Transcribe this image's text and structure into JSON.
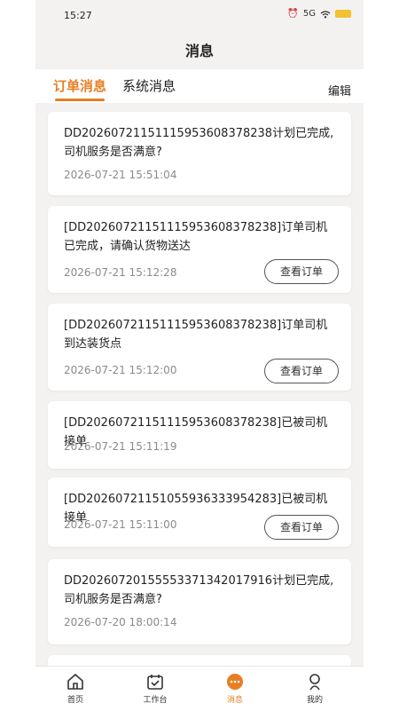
{
  "status": {
    "time": "15:27",
    "network": "5G"
  },
  "header": {
    "title": "消息"
  },
  "tabs": {
    "order_label": "订单消息",
    "system_label": "系统消息",
    "edit_label": "编辑"
  },
  "messages": [
    {
      "text": "DD20260721151115953608378238计划已完成,司机服务是否满意?",
      "time": "2026-07-21 15:51:04",
      "button": ""
    },
    {
      "text": "[DD20260721151115953608378238]订单司机已完成，请确认货物送达",
      "time": "2026-07-21 15:12:28",
      "button": "查看订单"
    },
    {
      "text": "[DD20260721151115953608378238]订单司机到达装货点",
      "time": "2026-07-21 15:12:00",
      "button": "查看订单"
    },
    {
      "text": "[DD20260721151115953608378238]已被司机接单",
      "time": "2026-07-21 15:11:19",
      "button": ""
    },
    {
      "text": "[DD20260721151055936333954283]已被司机接单",
      "time": "2026-07-21 15:11:00",
      "button": "查看订单"
    },
    {
      "text": "DD20260720155553371342017916计划已完成,司机服务是否满意?",
      "time": "2026-07-20 18:00:14",
      "button": ""
    }
  ],
  "bottom_nav": {
    "home": "首页",
    "workbench": "工作台",
    "messages": "消息",
    "mine": "我的"
  },
  "colors": {
    "accent": "#e87e22",
    "background": "#f3f2f1"
  },
  "icons": [
    "home-icon",
    "calendar-check-icon",
    "chat-bubble-icon",
    "user-icon",
    "wifi-icon",
    "battery-icon"
  ]
}
